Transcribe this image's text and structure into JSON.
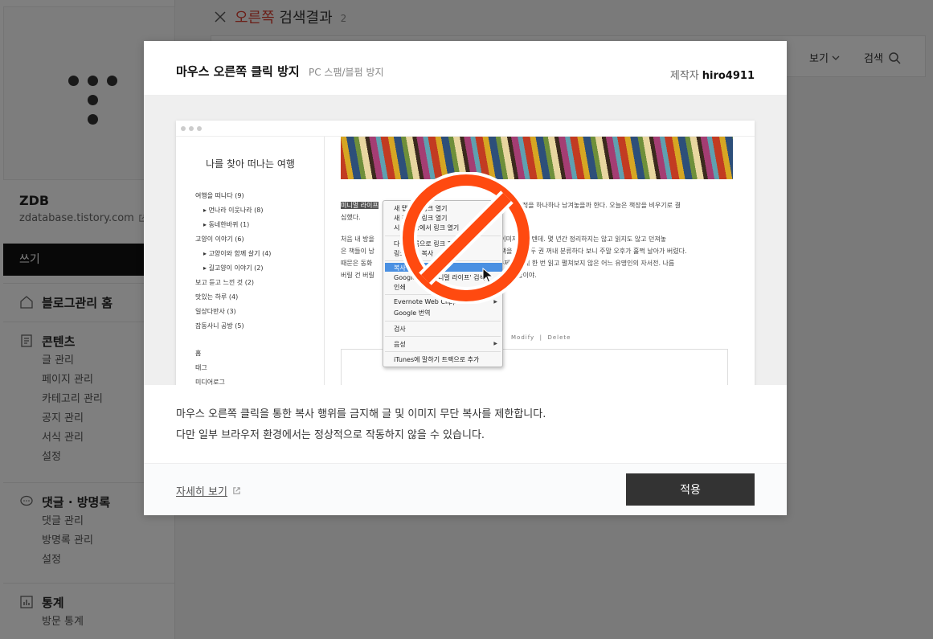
{
  "sidebar": {
    "blog_name": "ZDB",
    "blog_url": "zdatabase.tistory.com",
    "write_label": "쓰기",
    "sections": [
      {
        "title": "블로그관리 홈",
        "items": []
      },
      {
        "title": "콘텐츠",
        "items": [
          "글 관리",
          "페이지 관리",
          "카테고리 관리",
          "공지 관리",
          "서식 관리",
          "설정"
        ]
      },
      {
        "title": "댓글 · 방명록",
        "items": [
          "댓글 관리",
          "방명록 관리",
          "설정"
        ]
      },
      {
        "title": "통계",
        "items": [
          "방문 통계"
        ]
      }
    ]
  },
  "search": {
    "keyword": "오른쪽",
    "suffix": "검색결과",
    "count": "2"
  },
  "toolbar": {
    "view_label": "보기",
    "search_label": "검색"
  },
  "modal": {
    "title": "마우스 오른쪽 클릭 방지",
    "subtitle": "PC 스팸/블펌 방지",
    "maker_label": "제작자",
    "maker_name": "hiro4911",
    "desc_line1": "마우스 오른쪽 클릭을 통한 복사 행위를 금지해 글 및 이미지 무단 복사를 제한합니다.",
    "desc_line2": "다만 일부 브라우저 환경에서는 정상적으로 작동하지 않을 수 있습니다.",
    "more_label": "자세히 보기",
    "apply_label": "적용"
  },
  "preview": {
    "blog_title": "나를 찾아 떠나는 여행",
    "categories": [
      "여행을 떠나다 (9)",
      "먼나라 이웃나라 (8)",
      "동네한바퀴 (1)",
      "고양이 이야기 (6)",
      "고양이와 함께 살기 (4)",
      "길고양이 이야기 (2)",
      "보고 듣고 느낀 것 (2)",
      "맛있는 하루 (4)",
      "일상다반사 (3)",
      "잡동사니 공방 (5)"
    ],
    "nav": [
      "홈",
      "태그",
      "미디어로그"
    ],
    "highlight": "미니멀 라이프",
    "para1a": "고자 청소하는 과정을 하나하나 남겨놓을까 한다. 오늘은 책장을 비우기로 결",
    "para1b": "심했다.",
    "para2": [
      "처음 내 방을                                    인 오         서재의 이미지였을 텐데. 몇 년간 정리하지는 않고 읽지도 않고 던져놓",
      "은 책들이 남                                       는 거            로 책을 한 권 두 권 꺼내 분류하다 보니 주말 오후가 훌쩍 날아가 버렸다.",
      "때문은 동화                                         진        추억감 숙제 때문에 한 번 읽고 펼쳐보지 않은 어느 유명인의 자서전. 나름",
      "버릴 건 버릴                                                           이 많을 줄이야."
    ],
    "actions": "Modify  |  Delete",
    "context_menu": [
      "새 탭에서 링크 열기",
      "새 창에서 링크 열기",
      "시크릿 창에서 링크 열기",
      "다른 이름으로 링크 저장...",
      "링크 주소 복사",
      "복사",
      "Google에서 '미니멀 라이프' 검색",
      "인쇄",
      "Evernote Web Clipper",
      "Google 번역",
      "검사",
      "음성",
      "iTunes에 말하기 트랙으로 추가"
    ]
  },
  "colors": {
    "accent": "#d63c2e",
    "button_dark": "#333333",
    "no_sign": "#ff4a10"
  }
}
